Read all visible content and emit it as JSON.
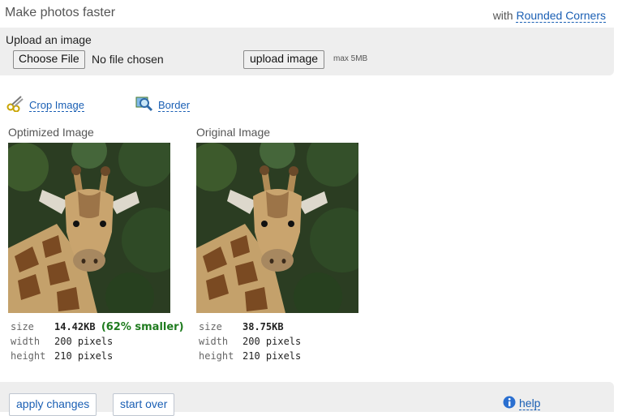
{
  "header": {
    "title": "Make photos faster",
    "with_prefix": "with",
    "with_link": "Rounded Corners"
  },
  "upload": {
    "label": "Upload an image",
    "choose_file": "Choose File",
    "file_status": "No file chosen",
    "upload_button": "upload image",
    "max_size": "max 5MB"
  },
  "tools": {
    "crop": {
      "label": "Crop Image",
      "icon": "scissors-icon"
    },
    "border": {
      "label": "Border",
      "icon": "magnifier-icon"
    }
  },
  "optimized": {
    "title": "Optimized Image",
    "size_label": "size",
    "size_value": "14.42KB",
    "savings": "(62% smaller)",
    "width_label": "width",
    "width_value": "200 pixels",
    "height_label": "height",
    "height_value": "210 pixels"
  },
  "original": {
    "title": "Original Image",
    "size_label": "size",
    "size_value": "38.75KB",
    "width_label": "width",
    "width_value": "200 pixels",
    "height_label": "height",
    "height_value": "210 pixels"
  },
  "footer": {
    "apply": "apply changes",
    "start_over": "start over",
    "help": "help",
    "help_icon": "info-icon"
  },
  "colors": {
    "link": "#1a5fb4",
    "panel": "#eeeeee",
    "savings": "#1e7b1e"
  }
}
